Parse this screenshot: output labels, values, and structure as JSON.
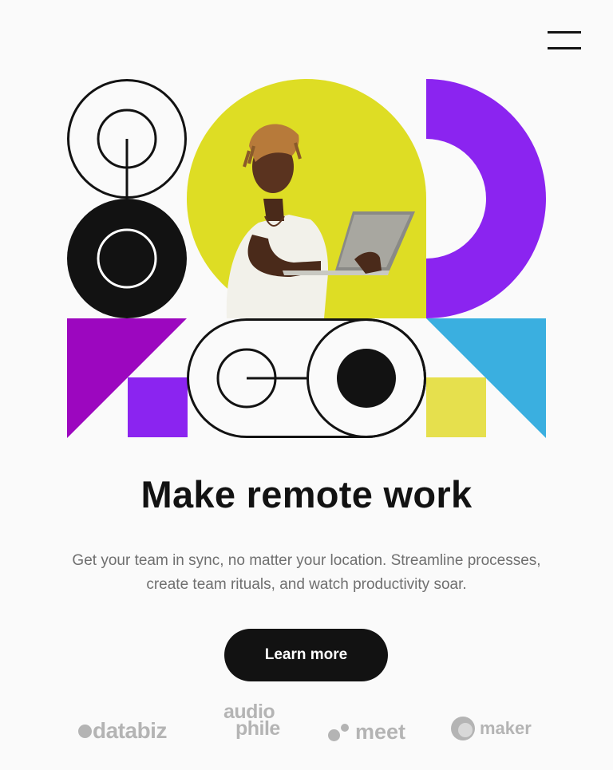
{
  "nav": {
    "menu_icon": "hamburger-icon"
  },
  "hero": {
    "illustration": "geometric-shapes-with-person-using-laptop",
    "colors": {
      "black": "#121212",
      "yellow_green": "#dedd24",
      "violet": "#8b24f0",
      "magenta": "#9c07bf",
      "cyan": "#3aafe0",
      "yellow": "#e6e04d"
    }
  },
  "headline": "Make remote work",
  "description": "Get your team in sync, no matter your location. Streamline processes, create team rituals, and watch productivity soar.",
  "cta": {
    "label": "Learn more"
  },
  "clients": {
    "databiz": "databiz",
    "audiophile_line1": "audio",
    "audiophile_line2": "phile",
    "meet": "meet",
    "maker": "maker"
  }
}
